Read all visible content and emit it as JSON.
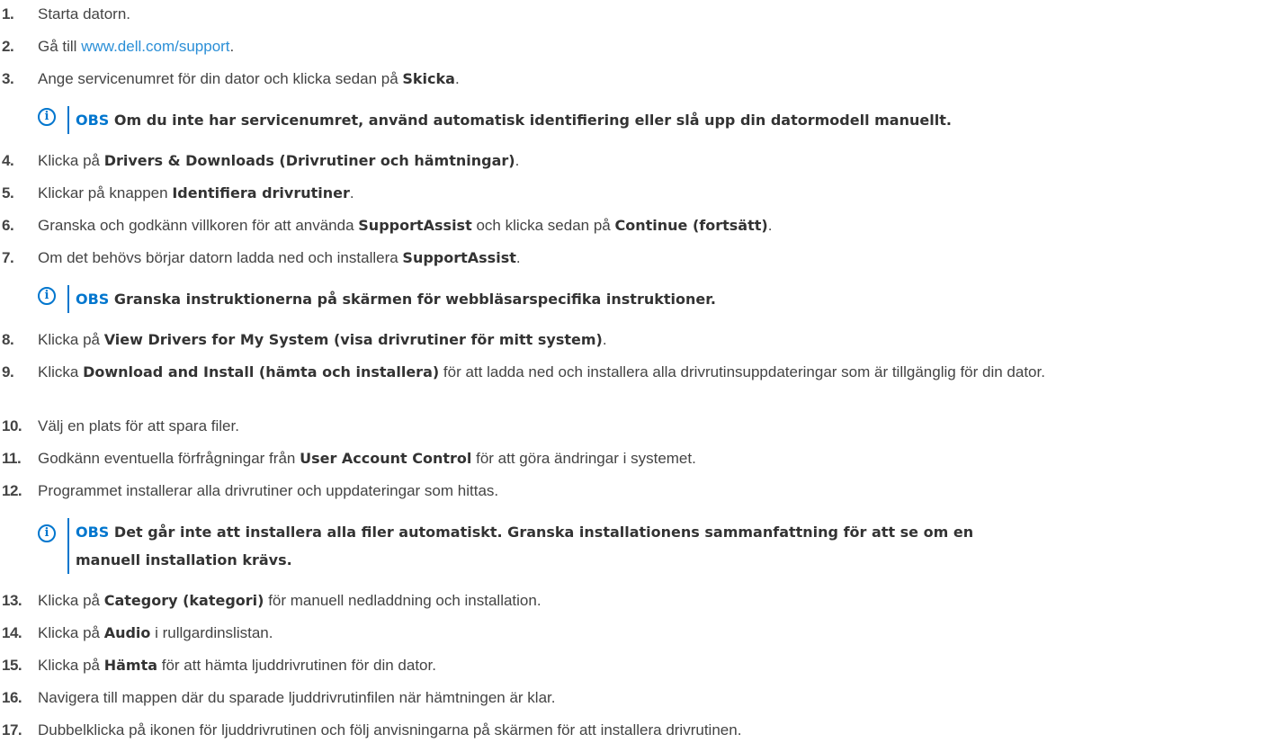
{
  "steps": [
    {
      "num": "1.",
      "parts": [
        {
          "t": "Starta datorn."
        }
      ]
    },
    {
      "num": "2.",
      "parts": [
        {
          "t": "Gå till "
        },
        {
          "t": "www.dell.com/support",
          "link": true
        },
        {
          "t": "."
        }
      ]
    },
    {
      "num": "3.",
      "parts": [
        {
          "t": "Ange servicenumret för din dator och klicka sedan på "
        },
        {
          "t": "Skicka",
          "b": true
        },
        {
          "t": "."
        }
      ]
    },
    {
      "num": "4.",
      "parts": [
        {
          "t": "Klicka på "
        },
        {
          "t": "Drivers & Downloads (Drivrutiner och hämtningar)",
          "b": true
        },
        {
          "t": "."
        }
      ]
    },
    {
      "num": "5.",
      "parts": [
        {
          "t": "Klickar på knappen "
        },
        {
          "t": "Identifiera drivrutiner",
          "b": true
        },
        {
          "t": "."
        }
      ]
    },
    {
      "num": "6.",
      "parts": [
        {
          "t": "Granska och godkänn villkoren för att använda "
        },
        {
          "t": "SupportAssist",
          "b": true
        },
        {
          "t": " och klicka sedan på "
        },
        {
          "t": "Continue (fortsätt)",
          "b": true
        },
        {
          "t": "."
        }
      ]
    },
    {
      "num": "7.",
      "parts": [
        {
          "t": "Om det behövs börjar datorn ladda ned och installera "
        },
        {
          "t": "SupportAssist",
          "b": true
        },
        {
          "t": "."
        }
      ]
    },
    {
      "num": "8.",
      "parts": [
        {
          "t": "Klicka på "
        },
        {
          "t": "View Drivers for My System (visa drivrutiner för mitt system)",
          "b": true
        },
        {
          "t": "."
        }
      ]
    },
    {
      "num": "9.",
      "parts": [
        {
          "t": "Klicka "
        },
        {
          "t": "Download and Install (hämta och installera)",
          "b": true
        },
        {
          "t": " för att ladda ned och installera alla drivrutinsuppdateringar som är tillgänglig för din dator."
        }
      ]
    },
    {
      "num": "10.",
      "parts": [
        {
          "t": "Välj en plats för att spara filer."
        }
      ]
    },
    {
      "num": "11.",
      "parts": [
        {
          "t": "Godkänn eventuella förfrågningar från "
        },
        {
          "t": "User Account Control",
          "b": true
        },
        {
          "t": " för att göra ändringar i systemet."
        }
      ]
    },
    {
      "num": "12.",
      "parts": [
        {
          "t": "Programmet installerar alla drivrutiner och uppdateringar som hittas."
        }
      ]
    },
    {
      "num": "13.",
      "parts": [
        {
          "t": "Klicka på "
        },
        {
          "t": "Category (kategori)",
          "b": true
        },
        {
          "t": " för manuell nedladdning och installation."
        }
      ]
    },
    {
      "num": "14.",
      "parts": [
        {
          "t": "Klicka på "
        },
        {
          "t": "Audio",
          "b": true
        },
        {
          "t": " i rullgardinslistan."
        }
      ]
    },
    {
      "num": "15.",
      "parts": [
        {
          "t": "Klicka på "
        },
        {
          "t": "Hämta",
          "b": true
        },
        {
          "t": " för att hämta ljuddrivrutinen för din dator."
        }
      ]
    },
    {
      "num": "16.",
      "parts": [
        {
          "t": "Navigera till mappen där du sparade ljuddrivrutinfilen när hämtningen är klar."
        }
      ]
    },
    {
      "num": "17.",
      "parts": [
        {
          "t": "Dubbelklicka på ikonen för ljuddrivrutinen och följ anvisningarna på skärmen för att installera drivrutinen."
        }
      ]
    }
  ],
  "notes": [
    {
      "icon": "info-icon",
      "label": "OBS",
      "text": "Om du inte har servicenumret, använd automatisk identifiering eller slå upp din datormodell manuellt."
    },
    {
      "icon": "info-icon",
      "label": "OBS",
      "text": "Granska instruktionerna på skärmen för webbläsarspecifika instruktioner."
    },
    {
      "icon": "info-icon",
      "label": "OBS",
      "text": "Det går inte att installera alla filer automatiskt. Granska installationens sammanfattning för att se om en manuell installation krävs."
    }
  ],
  "colors": {
    "link": "#2b8fd7",
    "note_accent": "#0076ce",
    "text": "#444444"
  }
}
